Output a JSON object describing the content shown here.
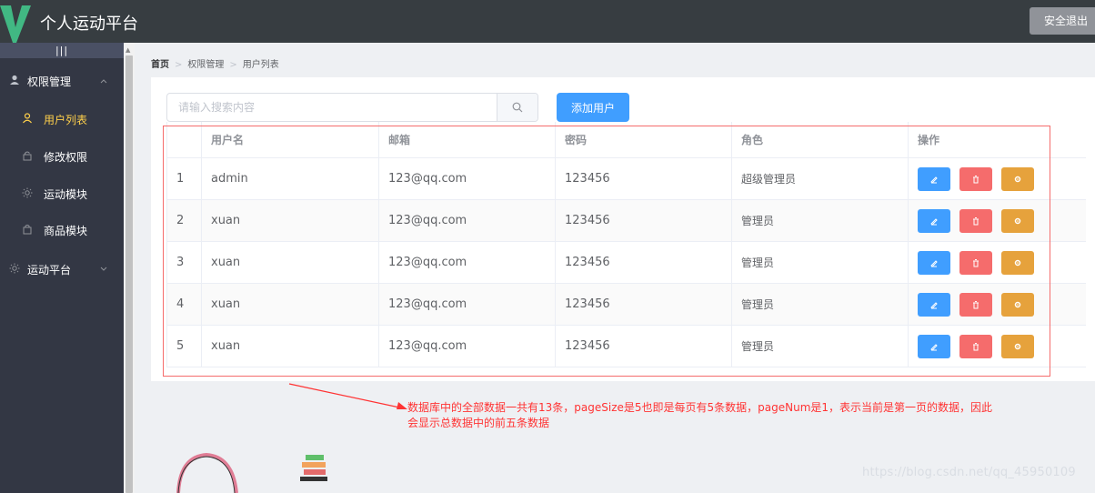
{
  "header": {
    "logo_icon": "vue-logo-icon",
    "title": "个人运动平台",
    "logout_label": "安全退出"
  },
  "sidebar": {
    "toggle_label": "|||",
    "menus": [
      {
        "label": "权限管理",
        "icon": "user-icon",
        "expanded": true,
        "items": [
          {
            "label": "用户列表",
            "icon": "user-outline-icon",
            "active": true
          },
          {
            "label": "修改权限",
            "icon": "lock-icon",
            "active": false
          },
          {
            "label": "运动模块",
            "icon": "sun-icon",
            "active": false
          },
          {
            "label": "商品模块",
            "icon": "shopping-bag-icon",
            "active": false
          }
        ]
      },
      {
        "label": "运动平台",
        "icon": "sun-icon",
        "expanded": false,
        "items": []
      }
    ]
  },
  "breadcrumb": [
    "首页",
    "权限管理",
    "用户列表"
  ],
  "search": {
    "placeholder": "请输入搜索内容",
    "value": ""
  },
  "add_user_label": "添加用户",
  "table": {
    "columns": [
      "",
      "用户名",
      "邮箱",
      "密码",
      "角色",
      "操作"
    ],
    "rows": [
      {
        "index": "1",
        "username": "admin",
        "email": "123@qq.com",
        "password": "123456",
        "role": "超级管理员"
      },
      {
        "index": "2",
        "username": "xuan",
        "email": "123@qq.com",
        "password": "123456",
        "role": "管理员"
      },
      {
        "index": "3",
        "username": "xuan",
        "email": "123@qq.com",
        "password": "123456",
        "role": "管理员"
      },
      {
        "index": "4",
        "username": "xuan",
        "email": "123@qq.com",
        "password": "123456",
        "role": "管理员"
      },
      {
        "index": "5",
        "username": "xuan",
        "email": "123@qq.com",
        "password": "123456",
        "role": "管理员"
      }
    ]
  },
  "annotation": {
    "line1": "数据库中的全部数据一共有13条，pageSize是5也即是每页有5条数据，pageNum是1，表示当前是第一页的数据，因此",
    "line2": "会显示总数据中的前五条数据"
  },
  "watermark": "https://blog.csdn.net/qq_45950109",
  "colors": {
    "header": "#373d41",
    "sidebar": "#333744",
    "active": "#ffd04b",
    "primary": "#409eff",
    "danger": "#f56c6c",
    "warning": "#e6a23c",
    "annotation": "#ff3333"
  }
}
